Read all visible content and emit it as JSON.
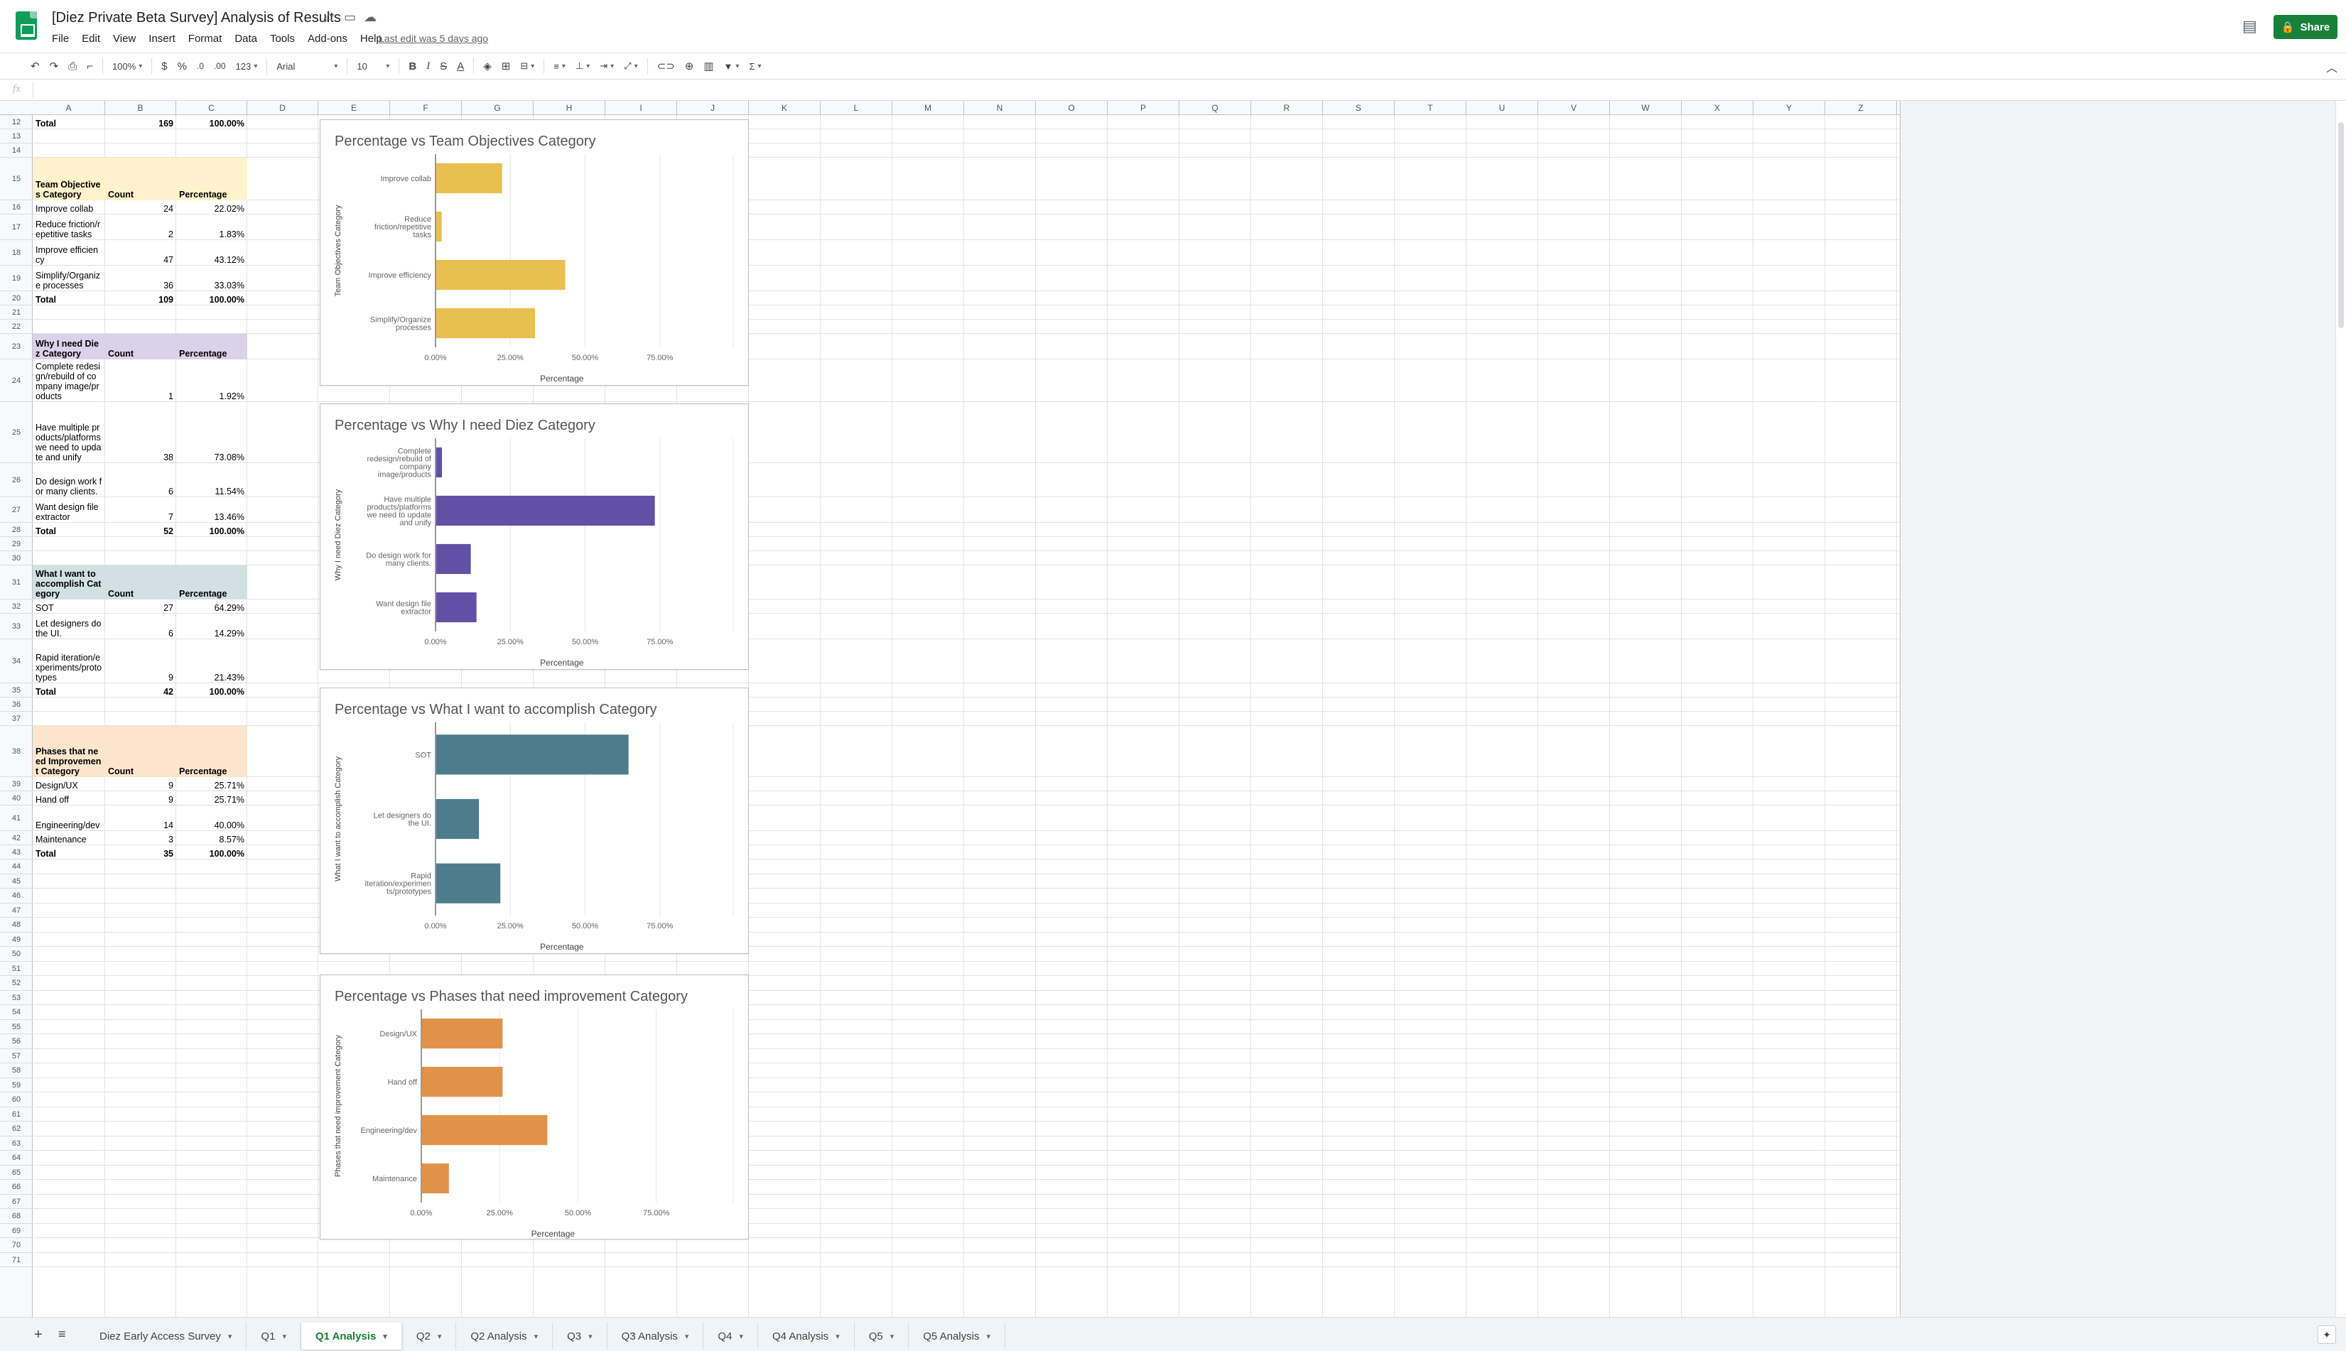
{
  "doc": {
    "title": "[Diez Private Beta Survey] Analysis of Results",
    "last_edit": "Last edit was 5 days ago",
    "share_label": "Share"
  },
  "menu": [
    "File",
    "Edit",
    "View",
    "Insert",
    "Format",
    "Data",
    "Tools",
    "Add-ons",
    "Help"
  ],
  "toolbar": {
    "zoom": "100%",
    "currency": "$",
    "percent": "%",
    "dec_decrease": ".0",
    "dec_increase": ".00",
    "more_formats": "123",
    "font": "Arial",
    "font_size": "10",
    "bold": "B",
    "italic": "I",
    "strike": "S",
    "text_color": "A"
  },
  "icons": {
    "undo": "undo-icon",
    "redo": "redo-icon",
    "print": "print-icon",
    "paint_format": "paint-format-icon",
    "star": "star-icon",
    "move": "move-folder-icon",
    "cloud": "cloud-status-icon",
    "comments": "comments-icon",
    "lock": "lock-icon",
    "fill": "fill-color-icon",
    "borders": "borders-icon",
    "merge": "merge-cells-icon",
    "link": "link-icon",
    "comment": "insert-comment-icon",
    "chart": "insert-chart-icon",
    "filter": "filter-icon",
    "functions": "functions-icon",
    "collapse": "chevron-up-icon"
  },
  "grid": {
    "columns": [
      "A",
      "B",
      "C",
      "D",
      "E",
      "F",
      "G",
      "H",
      "I",
      "J",
      "K",
      "L",
      "M",
      "N",
      "O",
      "P",
      "Q",
      "R",
      "S",
      "T",
      "U",
      "V",
      "W",
      "X",
      "Y",
      "Z"
    ],
    "rows": [
      "12",
      "13",
      "14",
      "15",
      "16",
      "17",
      "18",
      "19",
      "20",
      "21",
      "22",
      "23",
      "24",
      "25",
      "26",
      "27",
      "28",
      "29",
      "30",
      "31",
      "32",
      "33",
      "34",
      "35",
      "36",
      "37",
      "38",
      "39",
      "40",
      "41",
      "42",
      "43",
      "44",
      "45",
      "46",
      "47",
      "48",
      "49",
      "50",
      "51",
      "52",
      "53",
      "54",
      "55",
      "56",
      "57",
      "58",
      "59",
      "60",
      "61",
      "62",
      "63",
      "64",
      "65",
      "66",
      "67",
      "68",
      "69",
      "70",
      "71"
    ]
  },
  "tables": [
    {
      "header": [
        "Team Objectives Category",
        "Count",
        "Percentage"
      ],
      "color": "#fff2cc",
      "rows": [
        [
          "Improve collab",
          "24",
          "22.02%"
        ],
        [
          "Reduce friction/repetitive tasks",
          "2",
          "1.83%"
        ],
        [
          "Improve efficiency",
          "47",
          "43.12%"
        ],
        [
          "Simplify/Organize processes",
          "36",
          "33.03%"
        ]
      ],
      "total": [
        "Total",
        "109",
        "100.00%"
      ]
    },
    {
      "header": [
        "Why I need Diez Category",
        "Count",
        "Percentage"
      ],
      "color": "#d9d2e9",
      "rows": [
        [
          "Complete redesign/rebuild of company image/products",
          "1",
          "1.92%"
        ],
        [
          "Have multiple products/platforms we need to update and unify",
          "38",
          "73.08%"
        ],
        [
          "Do design work for many clients.",
          "6",
          "11.54%"
        ],
        [
          "Want design file extractor",
          "7",
          "13.46%"
        ]
      ],
      "total": [
        "Total",
        "52",
        "100.00%"
      ]
    },
    {
      "header": [
        "What I want to accomplish Category",
        "Count",
        "Percentage"
      ],
      "color": "#d0e0e3",
      "rows": [
        [
          "SOT",
          "27",
          "64.29%"
        ],
        [
          "Let designers do the UI.",
          "6",
          "14.29%"
        ],
        [
          "Rapid iteration/experiments/prototypes",
          "9",
          "21.43%"
        ]
      ],
      "total": [
        "Total",
        "42",
        "100.00%"
      ]
    },
    {
      "header": [
        "Phases that need Improvement Category",
        "Count",
        "Percentage"
      ],
      "color": "#fce5cd",
      "rows": [
        [
          "Design/UX",
          "9",
          "25.71%"
        ],
        [
          "Hand off",
          "9",
          "25.71%"
        ],
        [
          "Engineering/dev",
          "14",
          "40.00%"
        ],
        [
          "Maintenance",
          "3",
          "8.57%"
        ]
      ],
      "total": [
        "Total",
        "35",
        "100.00%"
      ]
    }
  ],
  "top_total": [
    "Total",
    "169",
    "100.00%"
  ],
  "chart_data": [
    {
      "type": "bar",
      "orientation": "horizontal",
      "title": "Percentage vs Team Objectives Category",
      "xlabel": "Percentage",
      "ylabel": "Team Objectives Category",
      "categories": [
        "Improve collab",
        "Reduce friction/repetitive tasks",
        "Improve efficiency",
        "Simplify/Organize processes"
      ],
      "category_lines": [
        [
          "Improve collab"
        ],
        [
          "Reduce",
          "friction/repetitive",
          "tasks"
        ],
        [
          "Improve efficiency"
        ],
        [
          "Simplify/Organize",
          "processes"
        ]
      ],
      "values": [
        22.02,
        1.83,
        43.12,
        33.03
      ],
      "xlim": [
        0,
        100
      ],
      "ticks": [
        "0.00%",
        "25.00%",
        "50.00%",
        "75.00%"
      ],
      "tick_values": [
        0,
        25,
        50,
        75
      ],
      "color": "#e9bf4f",
      "grid": true
    },
    {
      "type": "bar",
      "orientation": "horizontal",
      "title": "Percentage vs Why I need Diez Category",
      "xlabel": "Percentage",
      "ylabel": "Why I need Diez Category",
      "categories": [
        "Complete redesign/rebuild of company image/products",
        "Have multiple products/platforms we need to update and unify",
        "Do design work for many clients.",
        "Want design file extractor"
      ],
      "category_lines": [
        [
          "Complete",
          "redesign/rebuild of",
          "company",
          "image/products"
        ],
        [
          "Have multiple",
          "products/platforms",
          "we need to update",
          "and unify"
        ],
        [
          "Do design work for",
          "many clients."
        ],
        [
          "Want design file",
          "extractor"
        ]
      ],
      "values": [
        1.92,
        73.08,
        11.54,
        13.46
      ],
      "xlim": [
        0,
        100
      ],
      "ticks": [
        "0.00%",
        "25.00%",
        "50.00%",
        "75.00%"
      ],
      "tick_values": [
        0,
        25,
        50,
        75
      ],
      "color": "#6050a6",
      "grid": true
    },
    {
      "type": "bar",
      "orientation": "horizontal",
      "title": "Percentage vs What I want to accomplish Category",
      "xlabel": "Percentage",
      "ylabel": "What I want to accomplish Category",
      "categories": [
        "SOT",
        "Let designers do the UI.",
        "Rapid iteration/experiments/prototypes"
      ],
      "category_lines": [
        [
          "SOT"
        ],
        [
          "Let designers do",
          "the UI."
        ],
        [
          "Rapid",
          "iteration/experimen",
          "ts/prototypes"
        ]
      ],
      "values": [
        64.29,
        14.29,
        21.43
      ],
      "xlim": [
        0,
        100
      ],
      "ticks": [
        "0.00%",
        "25.00%",
        "50.00%",
        "75.00%"
      ],
      "tick_values": [
        0,
        25,
        50,
        75
      ],
      "color": "#4e7c8c",
      "grid": true
    },
    {
      "type": "bar",
      "orientation": "horizontal",
      "title": "Percentage vs Phases that need improvement Category",
      "xlabel": "Percentage",
      "ylabel": "Phases that need improvement Category",
      "categories": [
        "Design/UX",
        "Hand off",
        "Engineering/dev",
        "Maintenance"
      ],
      "category_lines": [
        [
          "Design/UX"
        ],
        [
          "Hand off"
        ],
        [
          "Engineering/dev"
        ],
        [
          "Maintenance"
        ]
      ],
      "values": [
        25.71,
        25.71,
        40.0,
        8.57
      ],
      "xlim": [
        0,
        100
      ],
      "ticks": [
        "0.00%",
        "25.00%",
        "50.00%",
        "75.00%"
      ],
      "tick_values": [
        0,
        25,
        50,
        75
      ],
      "color": "#e0924a",
      "grid": true
    }
  ],
  "sheet_tabs": [
    {
      "label": "Diez Early Access Survey",
      "active": false
    },
    {
      "label": "Q1",
      "active": false
    },
    {
      "label": "Q1 Analysis",
      "active": true
    },
    {
      "label": "Q2",
      "active": false
    },
    {
      "label": "Q2 Analysis",
      "active": false
    },
    {
      "label": "Q3",
      "active": false
    },
    {
      "label": "Q3 Analysis",
      "active": false
    },
    {
      "label": "Q4",
      "active": false
    },
    {
      "label": "Q4 Analysis",
      "active": false
    },
    {
      "label": "Q5",
      "active": false
    },
    {
      "label": "Q5 Analysis",
      "active": false
    }
  ],
  "bottom": {
    "add": "+",
    "all": "≡"
  }
}
